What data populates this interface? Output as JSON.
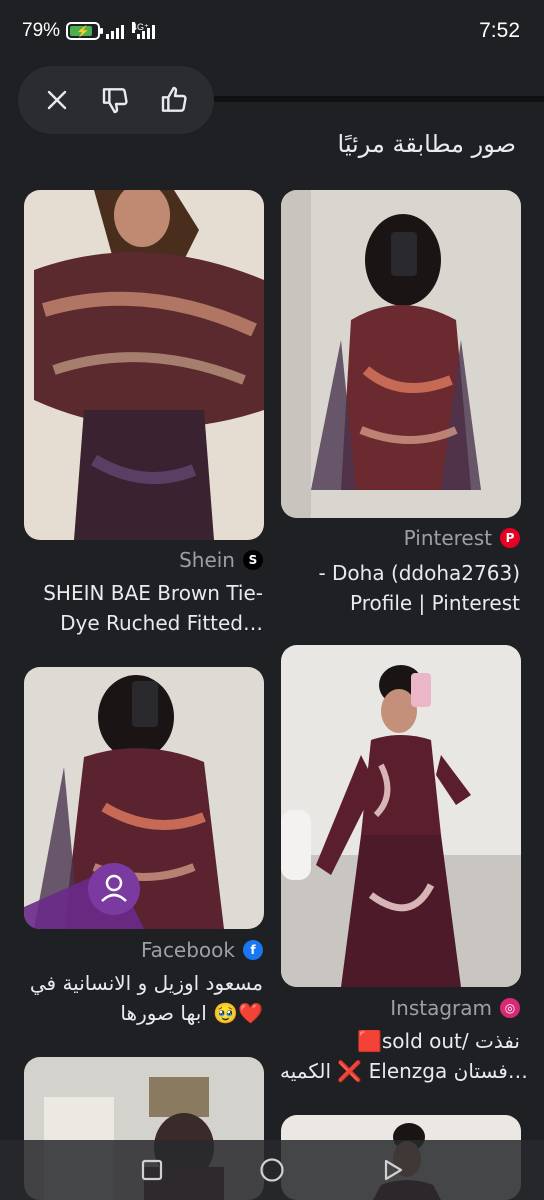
{
  "status_bar": {
    "battery": "79%",
    "network": "4G⁺",
    "time": "7:52"
  },
  "actions": {
    "close_icon": "close-icon",
    "dislike_icon": "thumbs-down-icon",
    "like_icon": "thumbs-up-icon"
  },
  "section": {
    "title": "صور مطابقة مرئيًا"
  },
  "results": [
    {
      "source": "Pinterest",
      "source_color": "#e60023",
      "caption_line1": "- Doha (ddoha2763)",
      "caption_line2": "Profile | Pinterest"
    },
    {
      "source": "Shein",
      "source_color": "#000000",
      "caption_line1": "SHEIN BAE Brown Tie-",
      "caption_line2": "Dye Ruched Fitted…"
    },
    {
      "source": "Instagram",
      "source_color": "#d62976",
      "caption_line1": "🟥sold out/ نفذت",
      "caption_line2": "الكميه ❌ Elenzga فستان…"
    },
    {
      "source": "Facebook",
      "source_color": "#1877f2",
      "caption_line1": "مسعود اوزيل و الانسانية في",
      "caption_line2": "ابها صورها 🥹❤️"
    }
  ],
  "nav": {
    "recents_icon": "square-icon",
    "home_icon": "circle-icon",
    "back_icon": "triangle-back-icon"
  }
}
